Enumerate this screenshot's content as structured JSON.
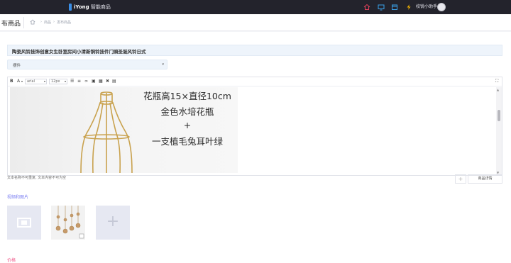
{
  "header": {
    "logo_brand": "iYong",
    "logo_suffix": "智能商品",
    "icons": [
      "home-icon",
      "monitor-icon",
      "store-icon",
      "lightning-icon"
    ],
    "user_name": "校锐小助手"
  },
  "breadcrumb": {
    "page_title": "布商品",
    "items": [
      "商品",
      "发布商品"
    ]
  },
  "form": {
    "product_name": "陶瓷风铃挂饰创意女生卧室房间小清新铜铃挂件门頭圣诞风铃日式",
    "category_select": "摆件"
  },
  "editor": {
    "toolbar": {
      "font_family": "arial",
      "font_size": "12px"
    },
    "image_caption_lines": [
      "花瓶高15×直径10cm",
      "金色水培花瓶",
      "+",
      "一支植毛兔耳叶绿"
    ]
  },
  "footer_row": {
    "note": "文本名称不可重复, 文本内容不可为空",
    "plus_label": "+",
    "detail_button": "商品详情"
  },
  "media": {
    "section_label": "视频和图片",
    "add_label": "+"
  },
  "price": {
    "section_label": "价格"
  },
  "colors": {
    "topbar": "#23232c",
    "accent_blue": "#3a8ee6",
    "media_label": "#7b7ff2",
    "price_label": "#f05a8a"
  }
}
